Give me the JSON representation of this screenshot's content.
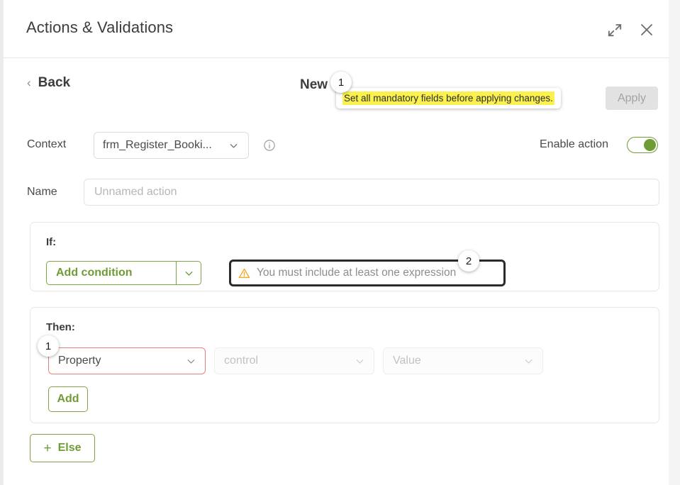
{
  "window": {
    "title": "Actions & Validations",
    "expand_icon": "expand-icon",
    "close_icon": "close-icon"
  },
  "action_bar": {
    "back_label": "Back",
    "back_chevron": "chevron-left-icon",
    "new_label": "New",
    "apply_label": "Apply",
    "apply_disabled": true
  },
  "tooltip": {
    "text": "Set all mandatory fields before applying changes.",
    "highlight_color": "#faf14e"
  },
  "context": {
    "label": "Context",
    "value": "frm_Register_Booki...",
    "caret_icon": "chevron-down-icon",
    "info_icon": "info-icon"
  },
  "enable_action": {
    "label": "Enable action",
    "state": "on",
    "accent_color": "#6f9c34"
  },
  "name": {
    "label": "Name",
    "value": "",
    "placeholder": "Unnamed action"
  },
  "if_section": {
    "legend": "If:",
    "add_condition_label": "Add condition",
    "caret_icon": "chevron-down-icon",
    "warning": {
      "icon": "warning-triangle-icon",
      "text": "You must include at least one expression"
    }
  },
  "then_section": {
    "legend": "Then:",
    "property_select": {
      "value": "Property",
      "caret_icon": "chevron-down-icon",
      "error_color": "#e8807d"
    },
    "control_select": {
      "placeholder": "control",
      "caret_icon": "chevron-down-icon",
      "disabled": true
    },
    "value_select": {
      "placeholder": "Value",
      "caret_icon": "chevron-down-icon",
      "disabled": true
    },
    "add_label": "Add"
  },
  "else_button": {
    "label": "Else",
    "plus_icon": "plus-icon"
  },
  "badges": {
    "apply": "1",
    "expression": "2",
    "property": "1"
  }
}
